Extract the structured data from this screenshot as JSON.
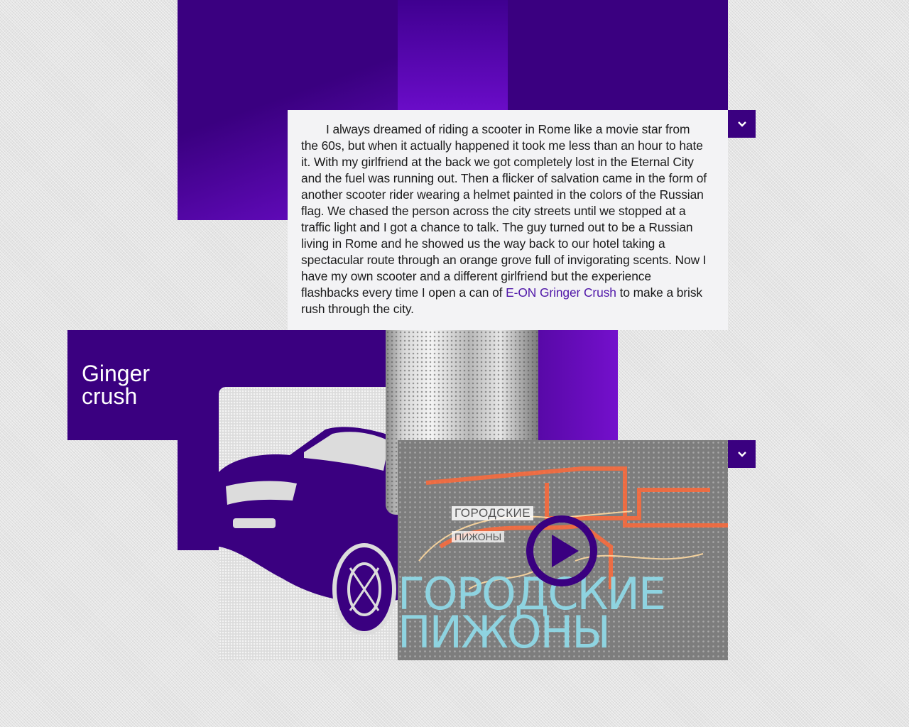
{
  "story": {
    "body": "I always dreamed of riding a scooter in Rome like a movie star from the 60s, but when it actually happened it took me less than an hour to hate it. With my girlfriend at the back we got completely lost in the Eternal City and the fuel was running out. Then a flicker of salvation came in the form of another scooter rider wearing a helmet painted in the colors of the Russian flag. We chased the person across the city streets until we stopped at a traffic light and I got a chance to talk. The guy turned out to be a Russian living in Rome and he showed us the way back to our hotel taking a spectacular route through an orange grove full of invigorating scents. Now I have my own scooter and a different girlfriend but the experience flashbacks every time I open a can of",
    "link_label": "E-ON Gringer Crush",
    "tail": "to make a brisk rush through the city."
  },
  "product": {
    "title_line1": "Ginger",
    "title_line2": "crush"
  },
  "video": {
    "label_line1": "ГОРОДСКИЕ",
    "label_line2": "ПИЖОНЫ",
    "big_title": "ГОРОДСКИЕ\nПИЖОНЫ"
  },
  "icons": {
    "toggle_top": "chevron-down-icon",
    "toggle_video": "chevron-down-icon",
    "play": "play-icon"
  },
  "colors": {
    "accent": "#3a0080",
    "accent_light": "#6a0cc8",
    "card_bg": "#f3f3f5",
    "link": "#4f16a8"
  }
}
